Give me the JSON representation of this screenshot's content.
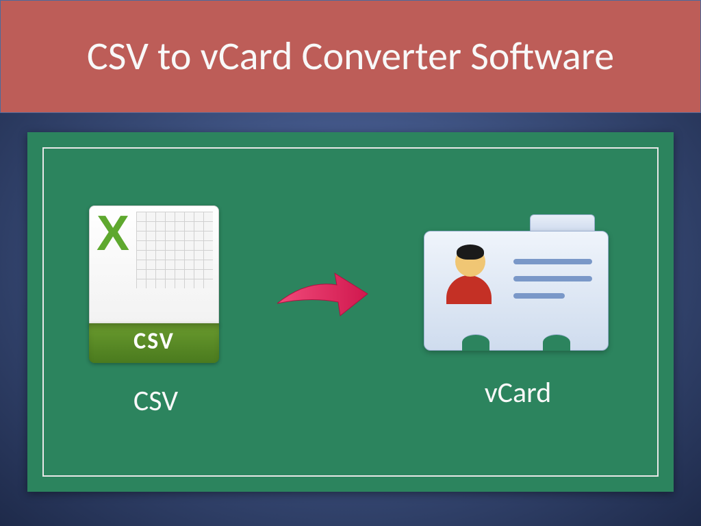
{
  "title": "CSV to vCard Converter Software",
  "panel": {
    "source": {
      "label": "CSV",
      "icon": {
        "x_letter": "X",
        "badge": "CSV"
      }
    },
    "target": {
      "label": "vCard"
    }
  },
  "colors": {
    "title_bg": "#bd5d58",
    "panel_bg": "#2c845e",
    "arrow": "#e02862"
  }
}
